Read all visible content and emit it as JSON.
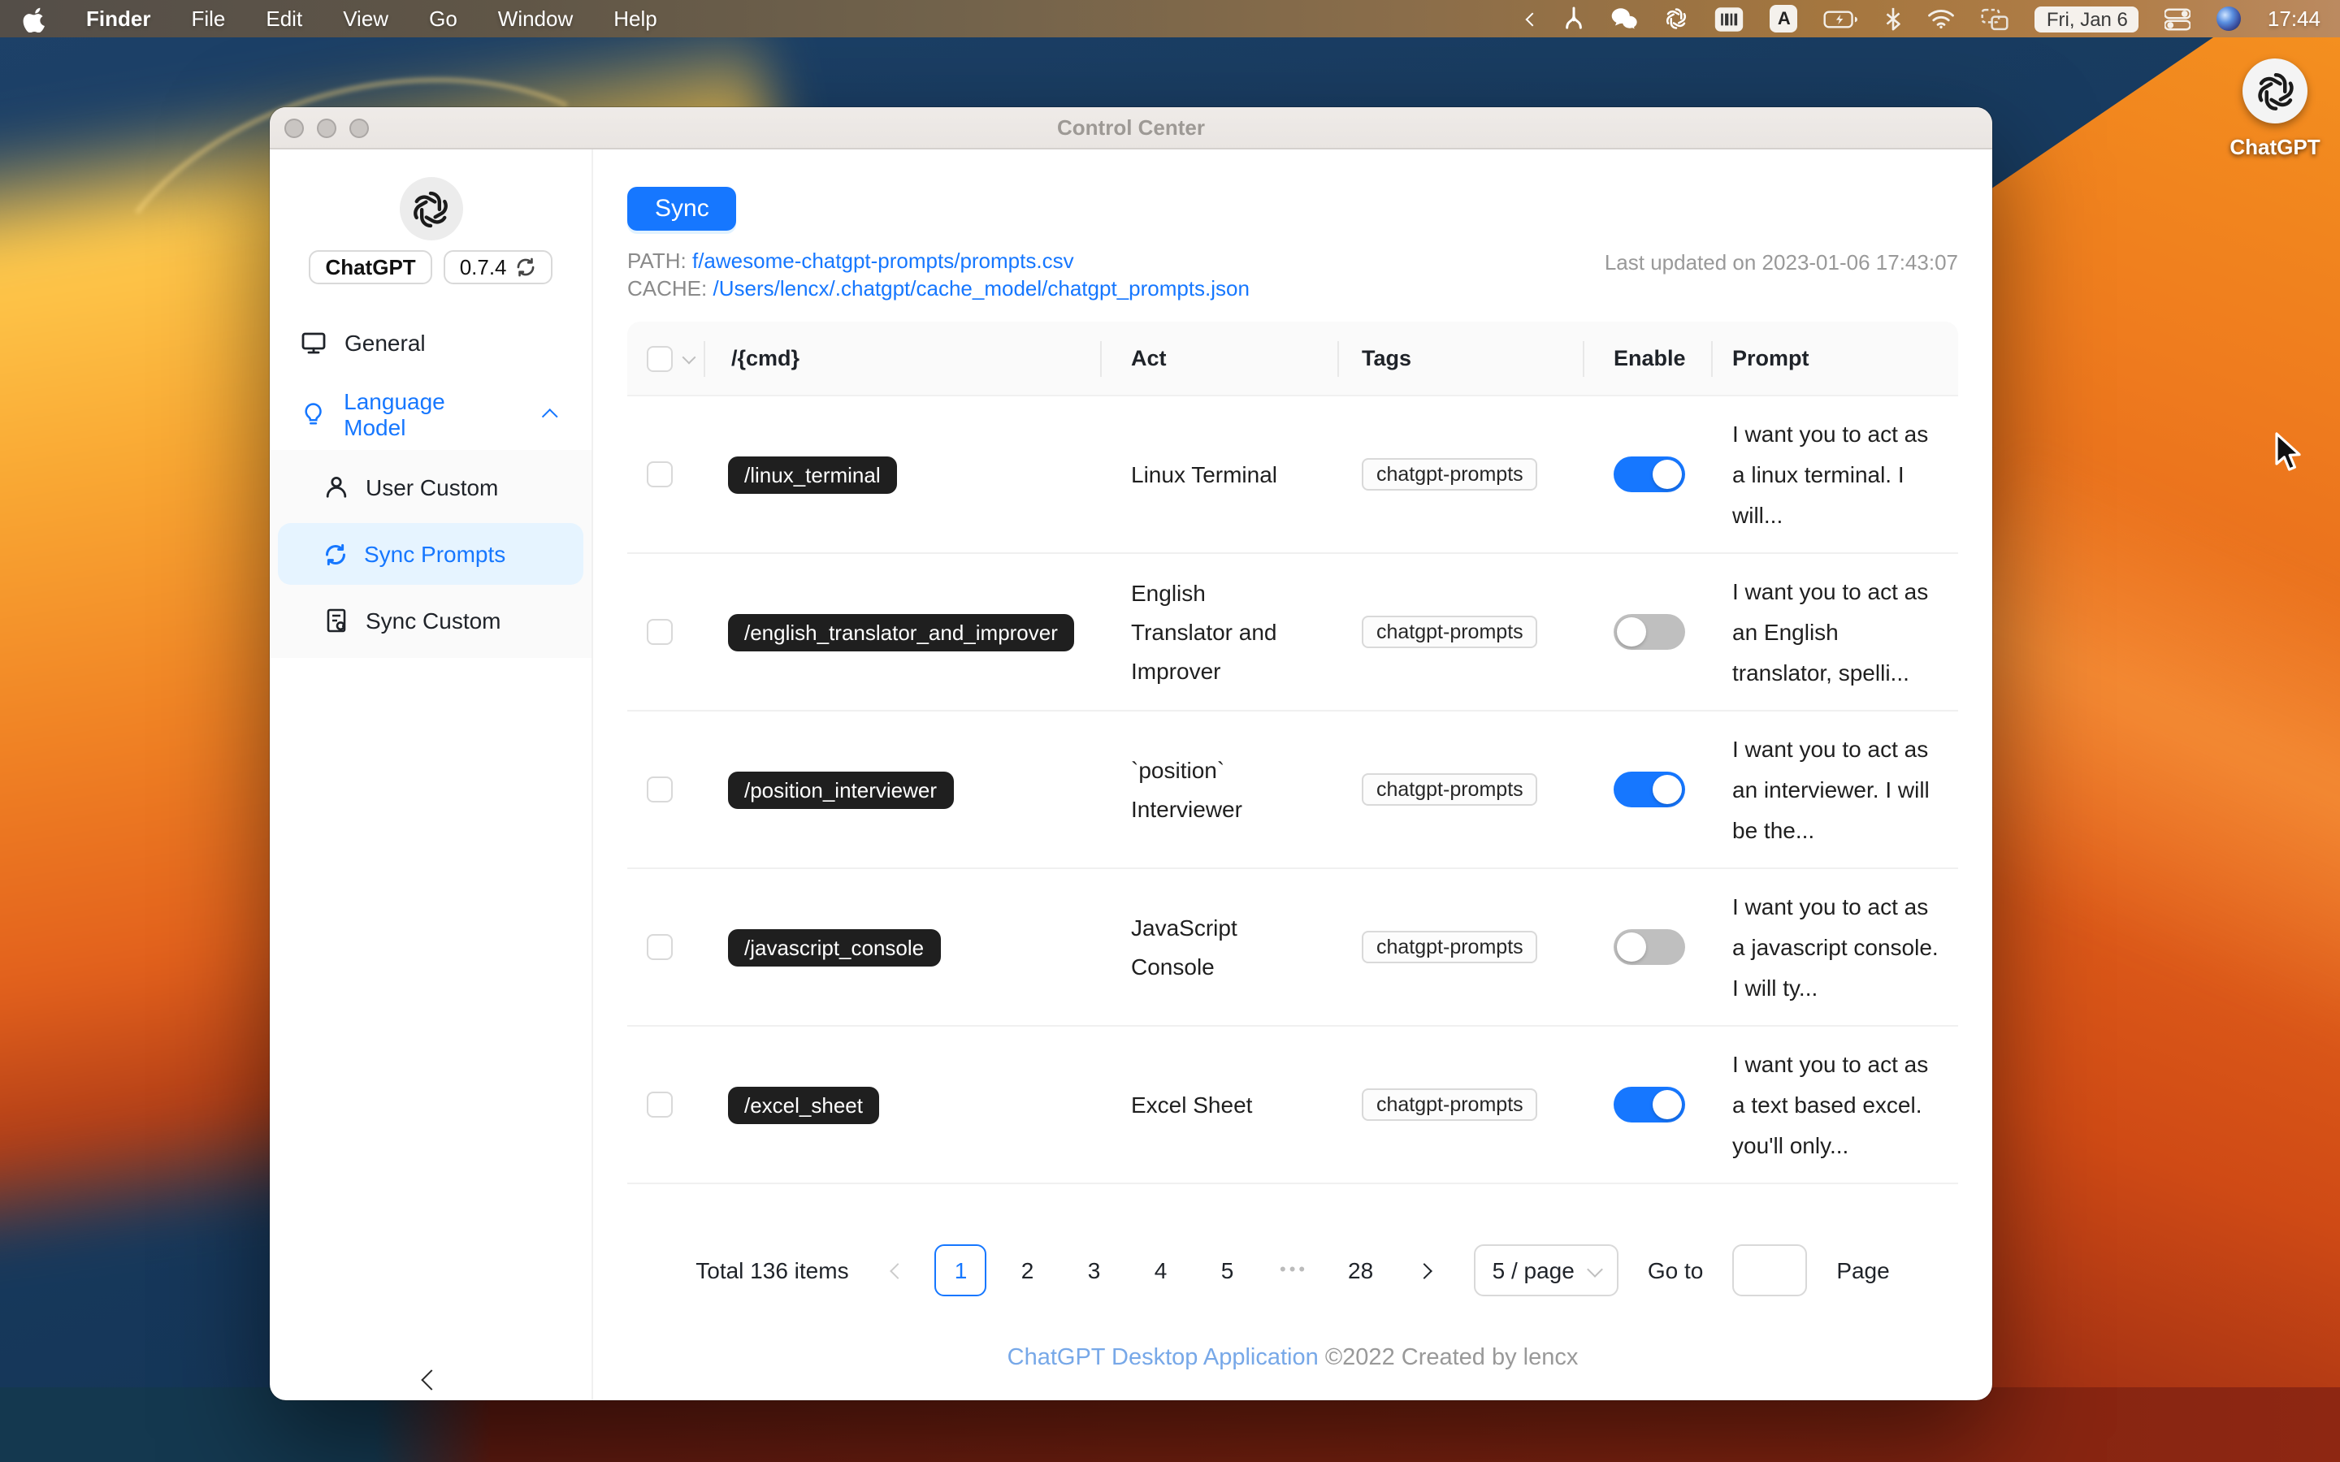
{
  "menu_bar": {
    "items": [
      "Finder",
      "File",
      "Edit",
      "View",
      "Go",
      "Window",
      "Help"
    ],
    "input_method": "A",
    "date": "Fri, Jan 6",
    "time": "17:44"
  },
  "desktop": {
    "chatgpt_icon_label": "ChatGPT"
  },
  "window": {
    "title": "Control Center",
    "sidebar": {
      "app_name": "ChatGPT",
      "version": "0.7.4",
      "general": "General",
      "language_model": "Language Model",
      "user_custom": "User Custom",
      "sync_prompts": "Sync Prompts",
      "sync_custom": "Sync Custom"
    },
    "content": {
      "sync_button": "Sync",
      "path_label": "PATH:",
      "path_value": "f/awesome-chatgpt-prompts/prompts.csv",
      "cache_label": "CACHE:",
      "cache_value": "/Users/lencx/.chatgpt/cache_model/chatgpt_prompts.json",
      "last_updated": "Last updated on 2023-01-06 17:43:07",
      "table": {
        "headers": {
          "cmd": "/{cmd}",
          "act": "Act",
          "tags": "Tags",
          "enable": "Enable",
          "prompt": "Prompt"
        },
        "rows": [
          {
            "cmd": "/linux_terminal",
            "act": "Linux Terminal",
            "tag": "chatgpt-prompts",
            "enabled": true,
            "prompt": "I want you to act as a linux terminal. I will..."
          },
          {
            "cmd": "/english_translator_and_improver",
            "act": "English Translator and Improver",
            "tag": "chatgpt-prompts",
            "enabled": false,
            "prompt": "I want you to act as an English translator, spelli..."
          },
          {
            "cmd": "/position_interviewer",
            "act": "`position` Interviewer",
            "tag": "chatgpt-prompts",
            "enabled": true,
            "prompt": "I want you to act as an interviewer. I will be the..."
          },
          {
            "cmd": "/javascript_console",
            "act": "JavaScript Console",
            "tag": "chatgpt-prompts",
            "enabled": false,
            "prompt": "I want you to act as a javascript console. I will ty..."
          },
          {
            "cmd": "/excel_sheet",
            "act": "Excel Sheet",
            "tag": "chatgpt-prompts",
            "enabled": true,
            "prompt": "I want you to act as a text based excel. you'll only..."
          }
        ]
      },
      "pagination": {
        "total": "Total 136 items",
        "pages": [
          "1",
          "2",
          "3",
          "4",
          "5",
          "•••",
          "28"
        ],
        "page_size": "5 / page",
        "goto_label": "Go to",
        "page_label": "Page"
      },
      "footer": {
        "link": "ChatGPT Desktop Application",
        "copyright": "©2022 Created by lencx"
      }
    }
  },
  "colors": {
    "accent": "#1677ff",
    "selected_item_bg": "#e6f4ff",
    "toggle_off": "#bfbfbf",
    "cmd_chip_bg": "#1f1f1f",
    "footer_link": "#77a8e8"
  }
}
